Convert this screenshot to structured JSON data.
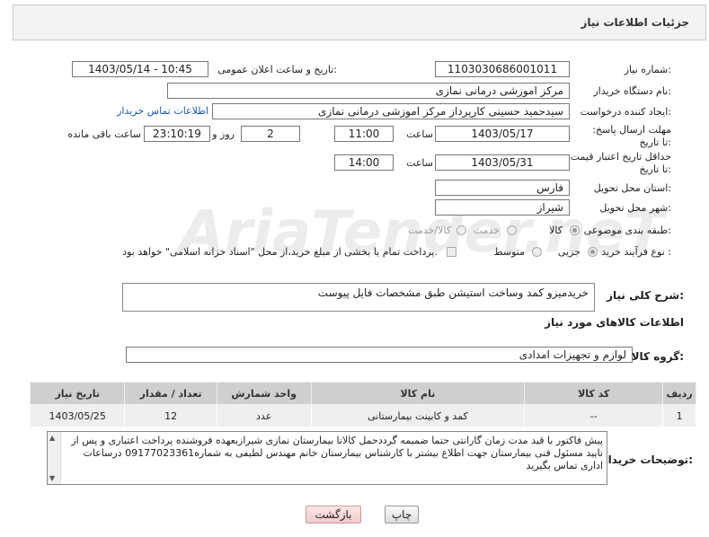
{
  "header": {
    "title": "جزئیات اطلاعات نیاز"
  },
  "watermark": "AriaTender.neT",
  "fields": {
    "need_number_label": "شماره نیاز:",
    "need_number": "1103030686001011",
    "announce_label": "تاریخ و ساعت اعلان عمومی:",
    "announce_value": "1403/05/14 - 10:45",
    "buyer_org_label": "نام دستگاه خریدار:",
    "buyer_org": "مرکز اموزشی درمانی نمازی",
    "creator_label": "ایجاد کننده درخواست:",
    "creator": "سیدحمید حسینی کارپرداز مرکز اموزشی درمانی نمازی",
    "contact_link": "اطلاعات تماس خریدار",
    "reply_deadline_label": "مهلت ارسال پاسخ: تا تاریخ:",
    "reply_date": "1403/05/17",
    "time_label": "ساعت",
    "reply_time": "11:00",
    "days_value": "2",
    "days_label": "روز و",
    "remaining_time": "23:10:19",
    "remaining_label": "ساعت باقی مانده",
    "price_deadline_label": "حداقل تاریخ اعتبار قیمت: تا تاریخ:",
    "price_date": "1403/05/31",
    "price_time": "14:00",
    "province_label": "استان محل تحویل:",
    "province": "فارس",
    "city_label": "شهر محل تحویل:",
    "city": "شیراز",
    "category_label": "طبقه بندی موضوعی:",
    "category_options": [
      "کالا",
      "خدمت",
      "کالا/خدمت"
    ],
    "process_label": "نوع فرآیند خرید :",
    "process_options": [
      "جزیی",
      "متوسط"
    ],
    "payment_note": "پرداخت تمام یا بخشی از مبلغ خرید،از محل \"اسناد خزانه اسلامی\" خواهد بود."
  },
  "description": {
    "label": "شرح کلی نیاز:",
    "value": "خریدمیزو کمد وساخت استیشن طبق مشخصات فایل پیوست"
  },
  "goods_info_title": "اطلاعات کالاهای مورد نیاز",
  "goods_group": {
    "label": "گروه کالا:",
    "value": "لوازم و تجهیزات امدادی"
  },
  "table": {
    "headers": [
      "ردیف",
      "کد کالا",
      "نام کالا",
      "واحد شمارش",
      "تعداد / مقدار",
      "تاریخ نیاز"
    ],
    "rows": [
      [
        "1",
        "--",
        "کمد و کابینت بیمارستانی",
        "عدد",
        "12",
        "1403/05/25"
      ]
    ]
  },
  "buyer_notes": {
    "label": "توضیحات خریدار:",
    "value": "پیش فاکتور با قید مدت زمان  گارانتی حتما ضمیمه گرددحمل کالاتا بیمارستان نمازی شیرازبعهده فروشنده پرداخت اعتباری و پس از تایید مسئول فنی بیمارستان جهت اطلاع بیشتر با کارشناس بیمارستان خانم مهندس لطیفی به شماره09177023361 درساعات اداری تماس بگیرید"
  },
  "buttons": {
    "print": "چاپ",
    "back": "بازگشت"
  }
}
